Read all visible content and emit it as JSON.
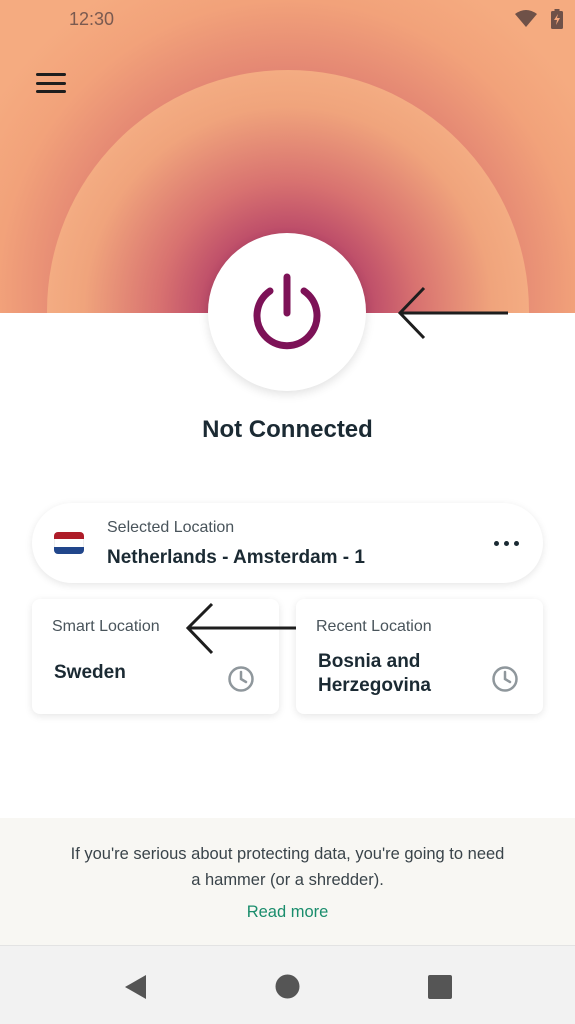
{
  "status_bar": {
    "time": "12:30",
    "icons": [
      "wifi-icon",
      "battery-charging-icon"
    ]
  },
  "header": {
    "menu_icon": "hamburger-menu-icon"
  },
  "connection": {
    "power_icon": "power-icon",
    "status": "Not Connected"
  },
  "selected_location": {
    "label": "Selected Location",
    "value": "Netherlands - Amsterdam - 1",
    "flag_icon": "netherlands-flag-icon",
    "more_icon": "more-options-icon",
    "flag_colors": [
      "#ae1c28",
      "#ffffff",
      "#21468b"
    ]
  },
  "smart_location": {
    "label": "Smart Location",
    "value": "Sweden",
    "icon": "clock-icon"
  },
  "recent_location": {
    "label": "Recent Location",
    "value_line1": "Bosnia and",
    "value_line2": "Herzegovina",
    "icon": "clock-icon"
  },
  "banner": {
    "text": "If you're serious about protecting data, you're going to need a hammer (or a shredder).",
    "link": "Read more"
  },
  "nav_bar": {
    "icons": [
      "back-icon",
      "home-icon",
      "recents-icon"
    ]
  },
  "colors": {
    "power": "#7d1257",
    "accent_link": "#1a8d6c",
    "text_dark": "#1b2a33"
  }
}
